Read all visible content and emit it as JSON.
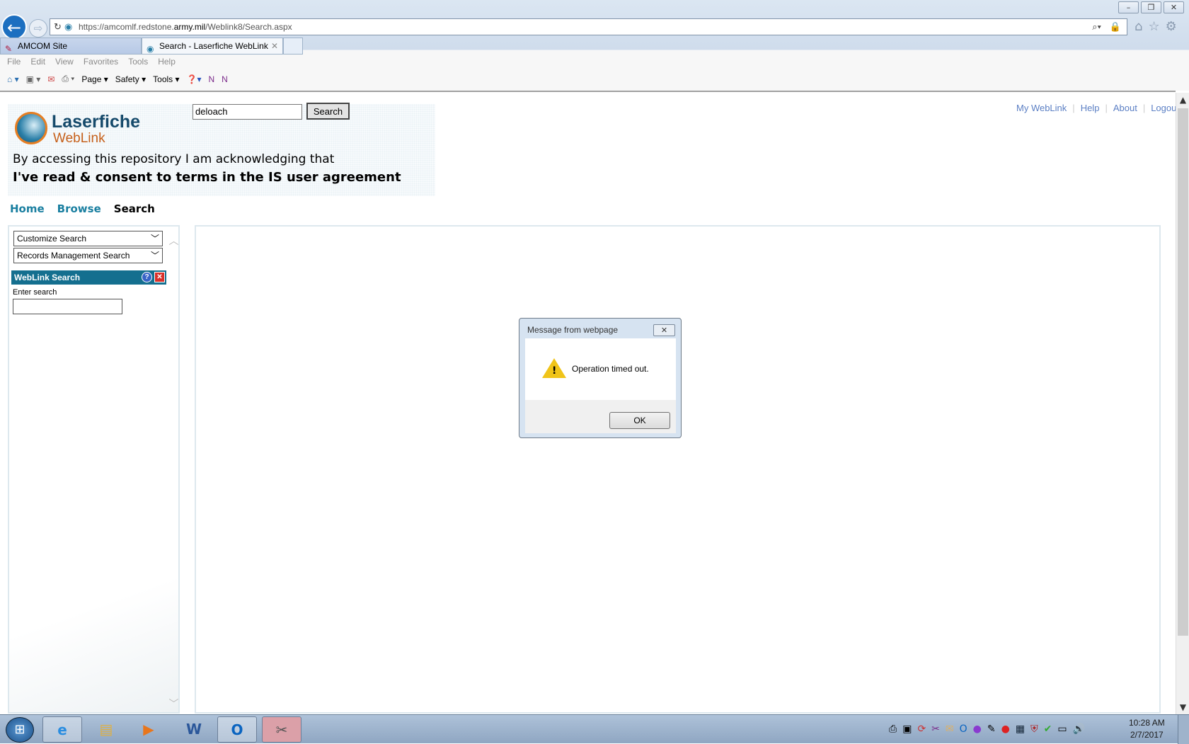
{
  "browser": {
    "url_prefix": "https://amcomlf.redstone.",
    "url_domain": "army.mil",
    "url_path": "/Weblink8/Search.aspx",
    "tabs": [
      {
        "label": "AMCOM Site",
        "active": false
      },
      {
        "label": "Search - Laserfiche WebLink",
        "active": true
      }
    ],
    "menu": [
      "File",
      "Edit",
      "View",
      "Favorites",
      "Tools",
      "Help"
    ],
    "toolbar": {
      "page": "Page ▾",
      "safety": "Safety ▾",
      "tools": "Tools ▾"
    }
  },
  "header": {
    "logo_line1": "Laserfiche",
    "logo_line2": "WebLink",
    "ack_line1": "By accessing this repository I am acknowledging that",
    "ack_line2": "I've read & consent to terms in the IS user agreement",
    "search_value": "deloach",
    "search_button": "Search",
    "links": [
      "My WebLink",
      "Help",
      "About",
      "Logout"
    ]
  },
  "nav": {
    "items": [
      {
        "label": "Home",
        "color": "#1a7fa0"
      },
      {
        "label": "Browse",
        "color": "#1a7fa0"
      },
      {
        "label": "Search",
        "color": "#000000"
      }
    ]
  },
  "sidebar": {
    "select1": "Customize Search",
    "select2": "Records Management Search",
    "panel_title": "WebLink Search",
    "enter_label": "Enter search",
    "enter_value": ""
  },
  "dialog": {
    "title": "Message from webpage",
    "message": "Operation timed out.",
    "ok": "OK",
    "icon": "warning-icon"
  },
  "taskbar": {
    "clock_time": "10:28 AM",
    "clock_date": "2/7/2017"
  },
  "colors": {
    "accent": "#146f8f",
    "link": "#5b7fc4"
  }
}
